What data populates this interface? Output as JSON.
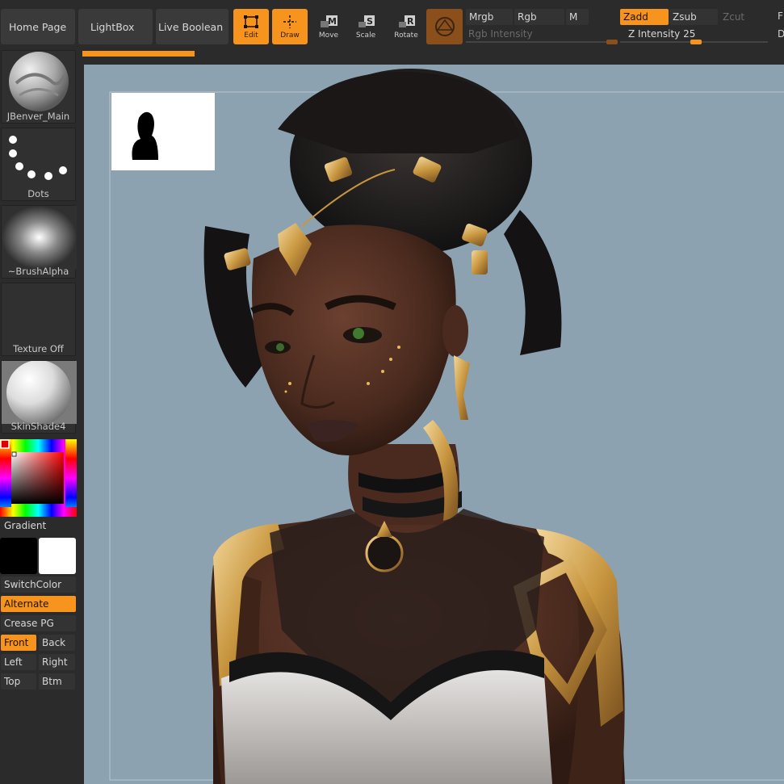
{
  "toolbar": {
    "home_page": "Home Page",
    "lightbox": "LightBox",
    "live_boolean": "Live Boolean",
    "tools": [
      {
        "label": "Edit",
        "icon": "edit-icon",
        "active": true
      },
      {
        "label": "Draw",
        "icon": "draw-icon",
        "active": true
      },
      {
        "label": "Move",
        "icon": "move-icon",
        "active": false
      },
      {
        "label": "Scale",
        "icon": "scale-icon",
        "active": false
      },
      {
        "label": "Rotate",
        "icon": "rotate-icon",
        "active": false
      }
    ],
    "mrgb": "Mrgb",
    "rgb": "Rgb",
    "m": "M",
    "rgb_intensity_label": "Rgb Intensity",
    "zadd": "Zadd",
    "zsub": "Zsub",
    "zcut": "Zcut",
    "z_intensity_label": "Z Intensity",
    "z_intensity_value": "25",
    "edge_f": "F",
    "edge_d": "D"
  },
  "shelf": {
    "brush": "JBenver_Main",
    "stroke": "Dots",
    "alpha": "~BrushAlpha",
    "texture": "Texture Off",
    "material": "SkinShade4",
    "gradient": "Gradient",
    "switch_color": "SwitchColor",
    "alternate": "Alternate",
    "crease_pg": "Crease PG",
    "front": "Front",
    "back": "Back",
    "left": "Left",
    "right": "Right",
    "top": "Top",
    "btm": "Btm"
  },
  "colors": {
    "accent": "#f7941d",
    "canvas_bg": "#8da2b1",
    "ui_bg": "#2b2b2b",
    "main_color": "#000000",
    "secondary_color": "#ffffff"
  },
  "progress": {
    "fraction": 0.16
  }
}
